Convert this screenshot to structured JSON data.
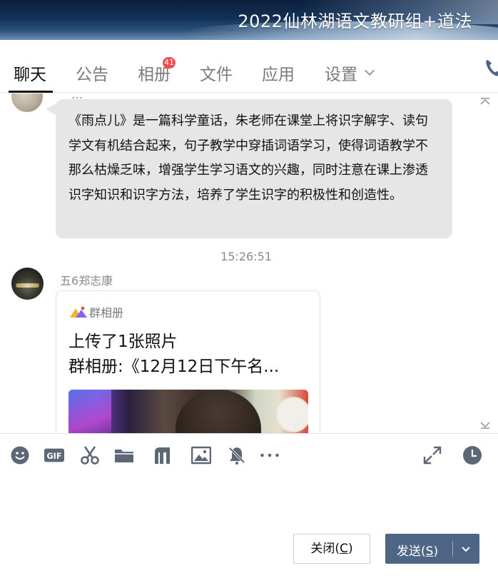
{
  "window": {
    "title": "2022仙林湖语文教研组+道法"
  },
  "tabs": {
    "items": [
      {
        "label": "聊天"
      },
      {
        "label": "公告"
      },
      {
        "label": "相册",
        "badge": "41"
      },
      {
        "label": "文件"
      },
      {
        "label": "应用"
      },
      {
        "label": "设置"
      }
    ],
    "active": "聊天"
  },
  "chat": {
    "prev_message": {
      "sender_partial": "…",
      "text": "《雨点儿》是一篇科学童话，朱老师在课堂上将识字解字、读句学文有机结合起来，句子教学中穿插词语学习，使得词语教学不那么枯燥乏味，增强学生学习语文的兴趣，同时注意在课上渗透识字知识和识字方法，培养了学生识字的积极性和创造性。"
    },
    "timestamp": "15:26:51",
    "message2": {
      "sender": "五6郑志康",
      "card_source": "群相册",
      "line1": "上传了1张照片",
      "line2": "群相册:《12月12日下午名..."
    }
  },
  "toolbar": {
    "icons": [
      "emoji-icon",
      "gif-icon",
      "scissors-icon",
      "folder-icon",
      "music-icon",
      "image-icon",
      "bell-off-icon",
      "more-icon",
      "expand-icon",
      "clock-icon"
    ],
    "gif_label": "GIF"
  },
  "actions": {
    "close_label": "关闭(C)",
    "close_text": "关闭(",
    "close_key": "C",
    "close_end": ")",
    "send_text": "发送(",
    "send_key": "S",
    "send_end": ")"
  },
  "colors": {
    "send_button": "#4f6585",
    "badge": "#f14d4d",
    "bubble": "#e6e6e6"
  }
}
